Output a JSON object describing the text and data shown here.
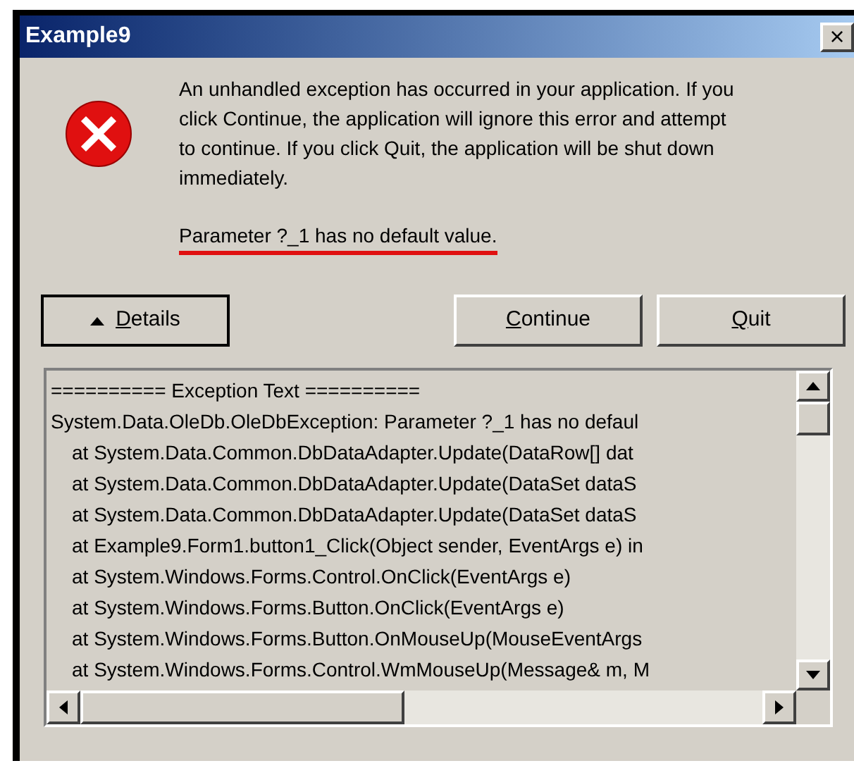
{
  "window": {
    "title": "Example9",
    "close": "×"
  },
  "message": {
    "text": "An unhandled exception has occurred in your application. If you click Continue, the application will ignore this error and attempt to continue. If you click Quit, the application will be shut down immediately.",
    "error": "Parameter ?_1 has no default value."
  },
  "buttons": [
    {
      "label": "Details",
      "kind": "toggle"
    },
    {
      "label": "Continue",
      "kind": "action"
    },
    {
      "label": "Quit",
      "kind": "action"
    }
  ],
  "details": {
    "lines": [
      {
        "text": "========== Exception Text =========="
      },
      {
        "text": "System.Data.OleDb.OleDbException: Parameter ?_1 has no defaul",
        "children": [
          {
            "text": "at System.Data.Common.DbDataAdapter.Update(DataRow[] dat"
          },
          {
            "text": "at System.Data.Common.DbDataAdapter.Update(DataSet dataS"
          },
          {
            "text": "at System.Data.Common.DbDataAdapter.Update(DataSet dataS"
          },
          {
            "text": "at Example9.Form1.button1_Click(Object sender, EventArgs e) in"
          },
          {
            "text": "at System.Windows.Forms.Control.OnClick(EventArgs e)"
          },
          {
            "text": "at System.Windows.Forms.Button.OnClick(EventArgs e)"
          },
          {
            "text": "at System.Windows.Forms.Button.OnMouseUp(MouseEventArgs"
          },
          {
            "text": "at System.Windows.Forms.Control.WmMouseUp(Message& m, M"
          }
        ]
      }
    ]
  }
}
